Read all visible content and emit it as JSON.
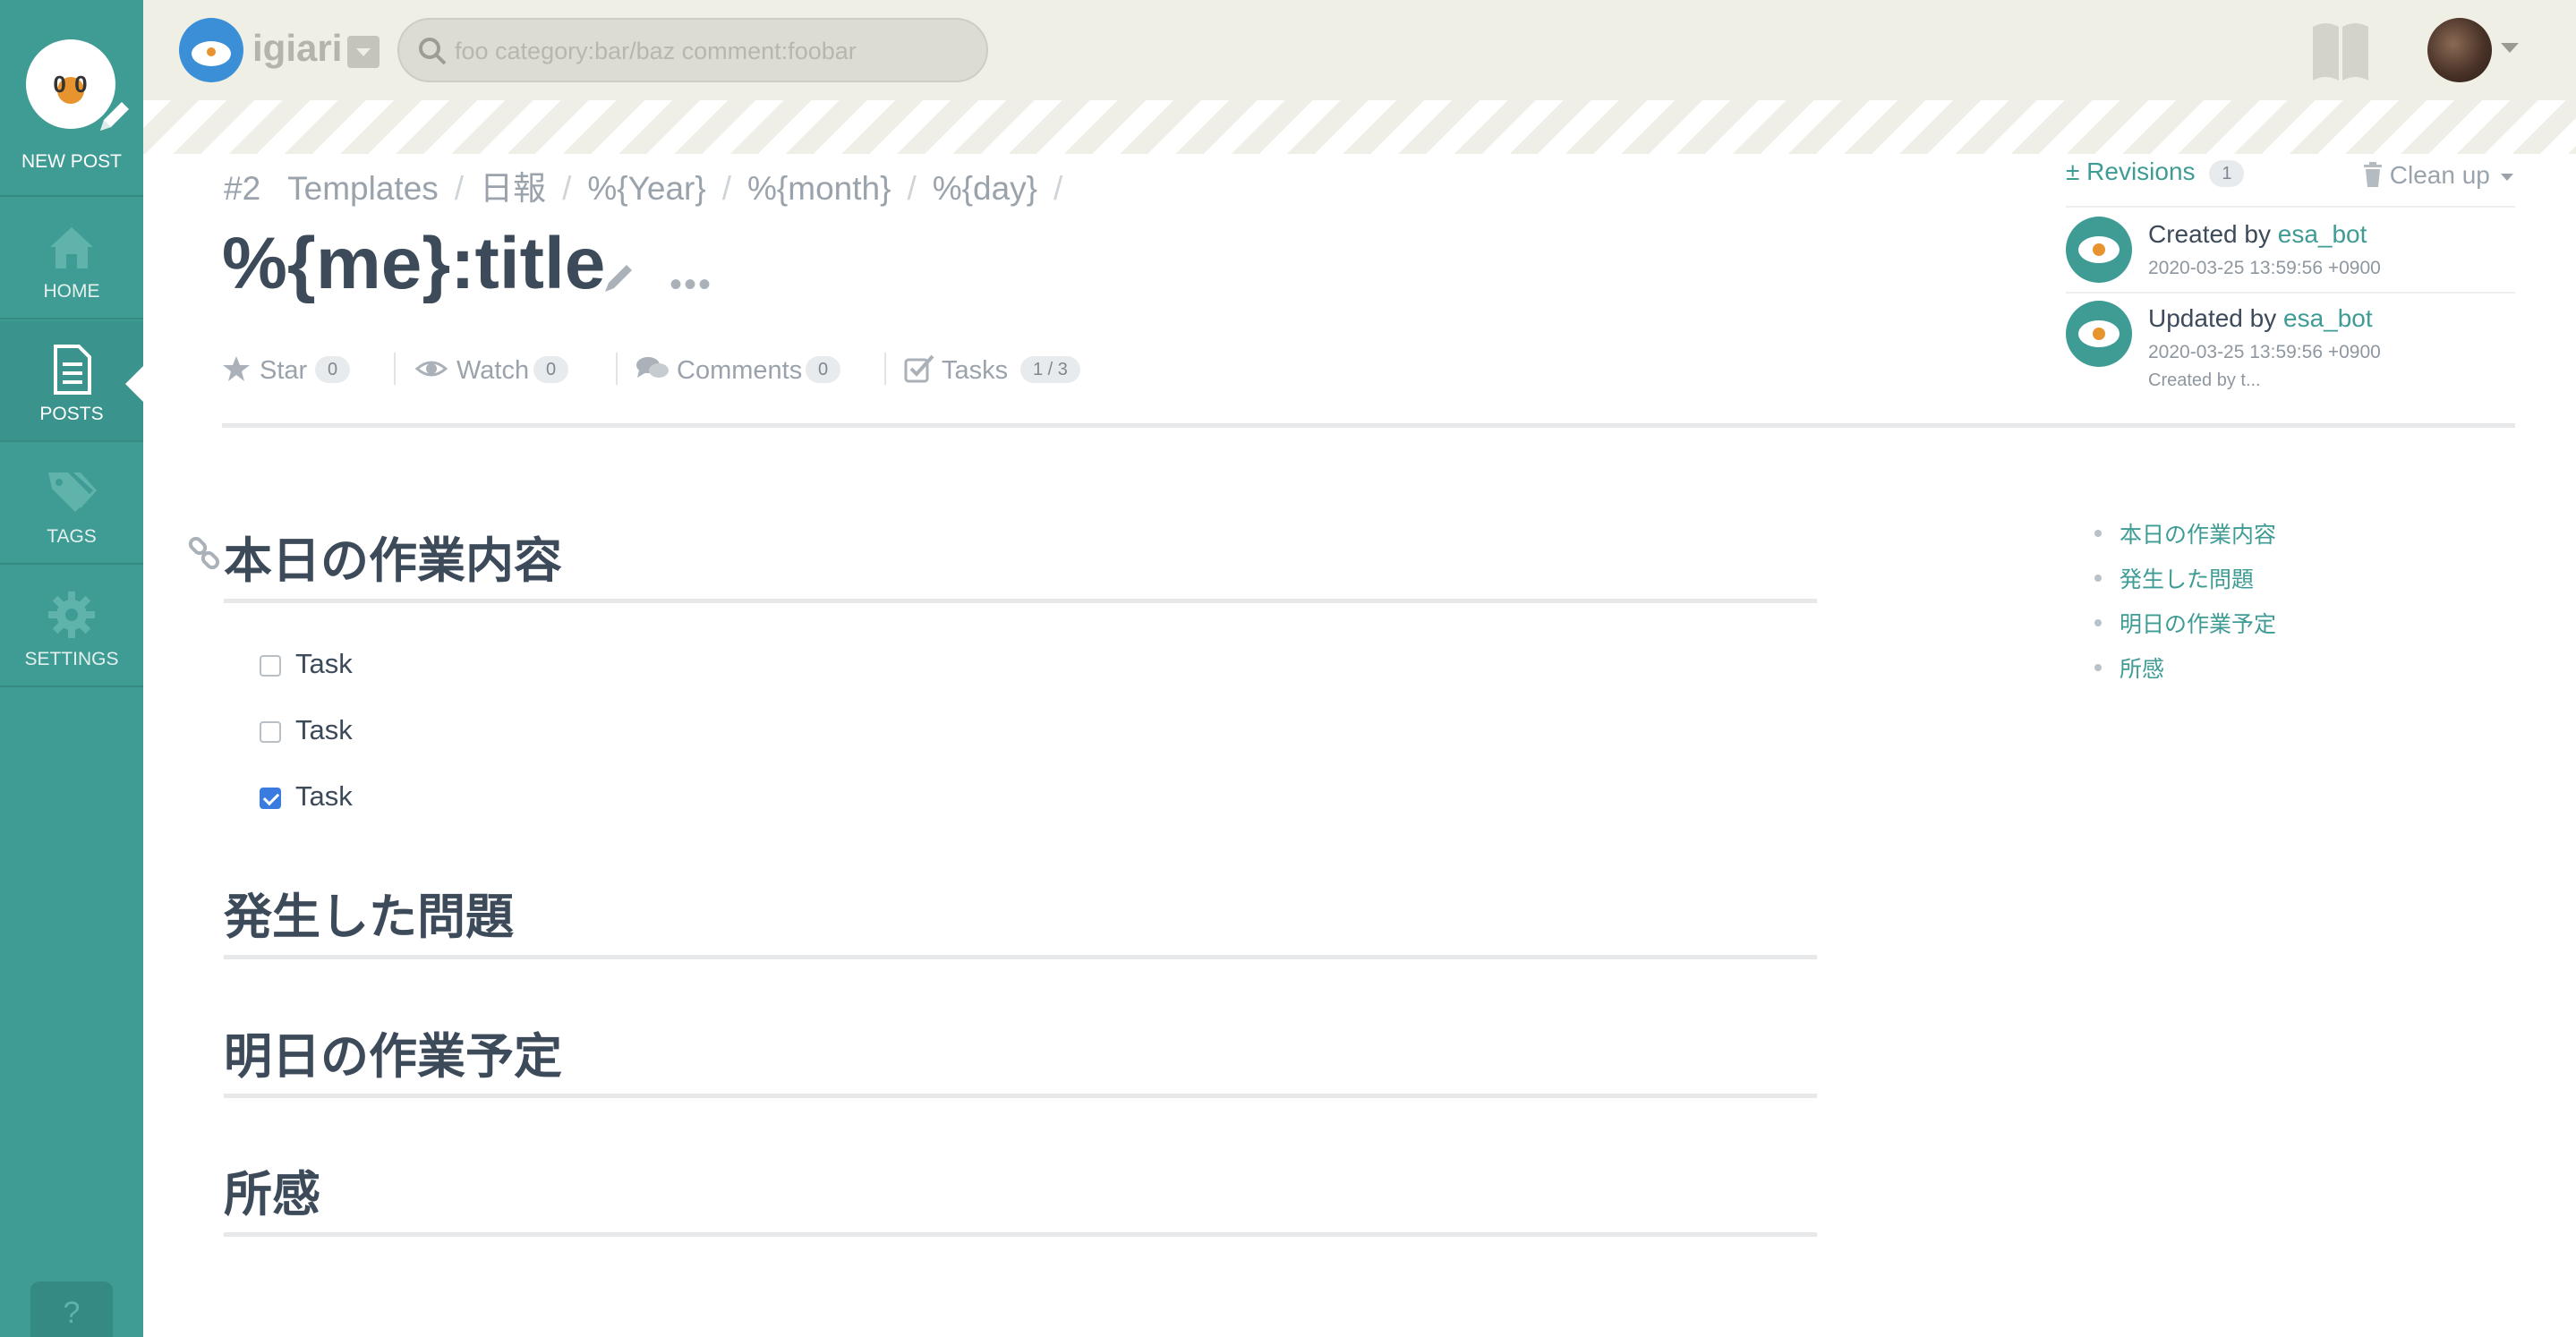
{
  "sidebar": {
    "new_post": {
      "label": "NEW POST",
      "logo_text": "0  0"
    },
    "items": [
      {
        "label": "HOME",
        "icon": "home-icon"
      },
      {
        "label": "POSTS",
        "icon": "document-icon"
      },
      {
        "label": "TAGS",
        "icon": "tags-icon"
      },
      {
        "label": "SETTINGS",
        "icon": "gear-icon"
      }
    ],
    "help": "?"
  },
  "header": {
    "team_name": "igiari",
    "search_placeholder": "foo category:bar/baz comment:foobar"
  },
  "post": {
    "number": "#2",
    "breadcrumb": [
      "Templates",
      "日報",
      "%{Year}",
      "%{month}",
      "%{day}"
    ],
    "breadcrumb_sep": "/",
    "title": "%{me}:title",
    "more": "•••",
    "meta": {
      "star": {
        "label": "Star",
        "count": "0"
      },
      "watch": {
        "label": "Watch",
        "count": "0"
      },
      "comments": {
        "label": "Comments",
        "count": "0"
      },
      "tasks": {
        "label": "Tasks",
        "count": "1 / 3"
      }
    }
  },
  "panel": {
    "revisions": {
      "icon": "±",
      "label": "Revisions",
      "count": "1"
    },
    "cleanup": "Clean up",
    "created": {
      "prefix": "Created by ",
      "user": "esa_bot",
      "time": "2020-03-25 13:59:56 +0900"
    },
    "updated": {
      "prefix": "Updated by ",
      "user": "esa_bot",
      "time": "2020-03-25 13:59:56 +0900",
      "note": "Created by t..."
    },
    "toc": [
      "本日の作業内容",
      "発生した問題",
      "明日の作業予定",
      "所感"
    ]
  },
  "content": {
    "sections": [
      "本日の作業内容",
      "発生した問題",
      "明日の作業予定",
      "所感"
    ],
    "tasks": [
      {
        "label": "Task",
        "checked": false
      },
      {
        "label": "Task",
        "checked": false
      },
      {
        "label": "Task",
        "checked": true
      }
    ]
  },
  "colors": {
    "accent": "#3f9c95",
    "header_bg": "#efefe6",
    "checkbox": "#3a7be0",
    "text": "#3c4a5a"
  }
}
